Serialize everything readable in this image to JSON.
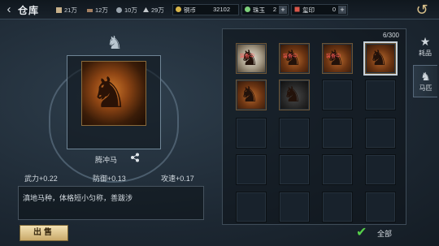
{
  "header": {
    "back_icon": "‹",
    "title": "仓库",
    "resources": [
      {
        "icon": "food-icon",
        "value": "21万"
      },
      {
        "icon": "wood-icon",
        "value": "12万"
      },
      {
        "icon": "stone-icon",
        "value": "10万"
      },
      {
        "icon": "iron-icon",
        "value": "29万"
      }
    ],
    "currencies": [
      {
        "icon": "copper-coin-icon",
        "label": "铜币",
        "value": "32102"
      },
      {
        "icon": "jade-icon",
        "label": "珠玉",
        "value": "2"
      },
      {
        "icon": "seal-icon",
        "label": "玺印",
        "value": "0"
      }
    ],
    "exit_icon": "↺"
  },
  "horse": {
    "name": "腾冲马",
    "stats": [
      {
        "label": "武力+0.22"
      },
      {
        "label": "防御+0.13"
      },
      {
        "label": "攻速+0.17"
      }
    ],
    "description": "滇地马种，体格短小匀称，善跋涉"
  },
  "actions": {
    "sell_label": "出售",
    "all_label": "全部"
  },
  "inventory": {
    "count": "6/300",
    "slots": [
      {
        "type": "white",
        "tag": "装备中"
      },
      {
        "type": "filled",
        "tag": "装备中"
      },
      {
        "type": "filled",
        "tag": "装备中"
      },
      {
        "type": "filled",
        "tag": ""
      },
      {
        "type": "filled",
        "tag": ""
      },
      {
        "type": "dark",
        "tag": ""
      }
    ]
  },
  "tabs": [
    {
      "label": "耗品",
      "icon": "bag-icon"
    },
    {
      "label": "马匹",
      "icon": "horse-icon"
    }
  ]
}
